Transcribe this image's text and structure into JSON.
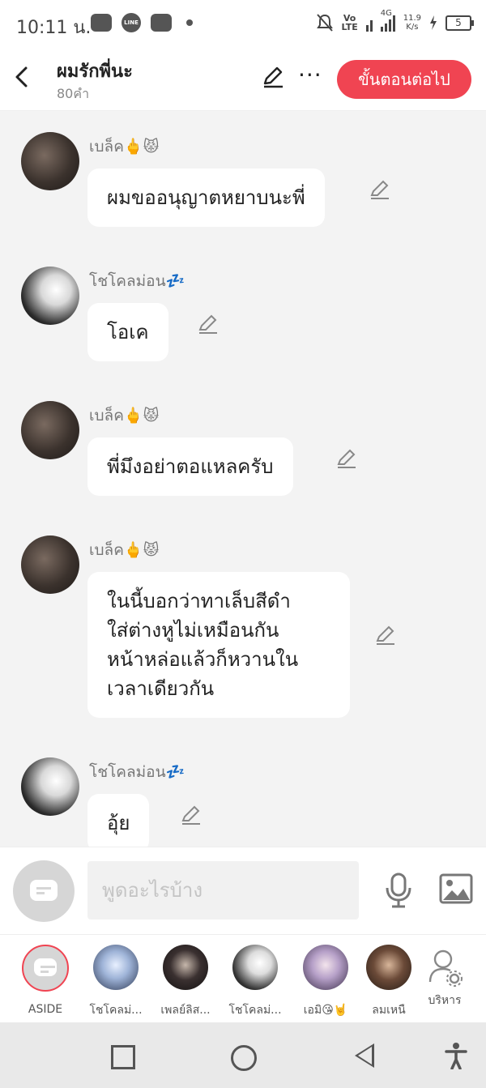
{
  "status_bar": {
    "time": "10:11 น.",
    "volte_line1": "Vo",
    "volte_line2": "LTE",
    "network": "4G",
    "speed_value": "11.9",
    "speed_unit": "K/s",
    "battery": "5"
  },
  "header": {
    "title": "ผมรักพี่นะ",
    "word_count": "80คำ",
    "next_button": "ขั้นตอนต่อไป",
    "more_symbol": "···"
  },
  "messages": [
    {
      "sender": "เบล็ค🖕😾",
      "text": "ผมขออนุญาตหยาบนะพี่"
    },
    {
      "sender": "โชโคลม่อน💤",
      "text": "โอเค"
    },
    {
      "sender": "เบล็ค🖕😾",
      "text": "พี่มึงอย่าตอแหลครับ"
    },
    {
      "sender": "เบล็ค🖕😾",
      "text": "ในนี้บอกว่าทาเล็บสีดำ\nใส่ต่างหูไม่เหมือนกัน\nหน้าหล่อแล้วก็หวานใน\nเวลาเดียวกัน"
    },
    {
      "sender": "โชโคลม่อน💤",
      "text": "อุ้ย"
    }
  ],
  "composer": {
    "placeholder": "พูดอะไรบ้าง"
  },
  "characters": [
    {
      "label": "ASIDE"
    },
    {
      "label": "โชโคลม่..."
    },
    {
      "label": "เพลย์ลิส..."
    },
    {
      "label": "โชโคลม่..."
    },
    {
      "label": "เอมิ😘🤘"
    },
    {
      "label": "ลมเหนื"
    },
    {
      "label": "บริหาร"
    }
  ],
  "colors": {
    "accent": "#f04452",
    "background": "#f3f3f3"
  }
}
